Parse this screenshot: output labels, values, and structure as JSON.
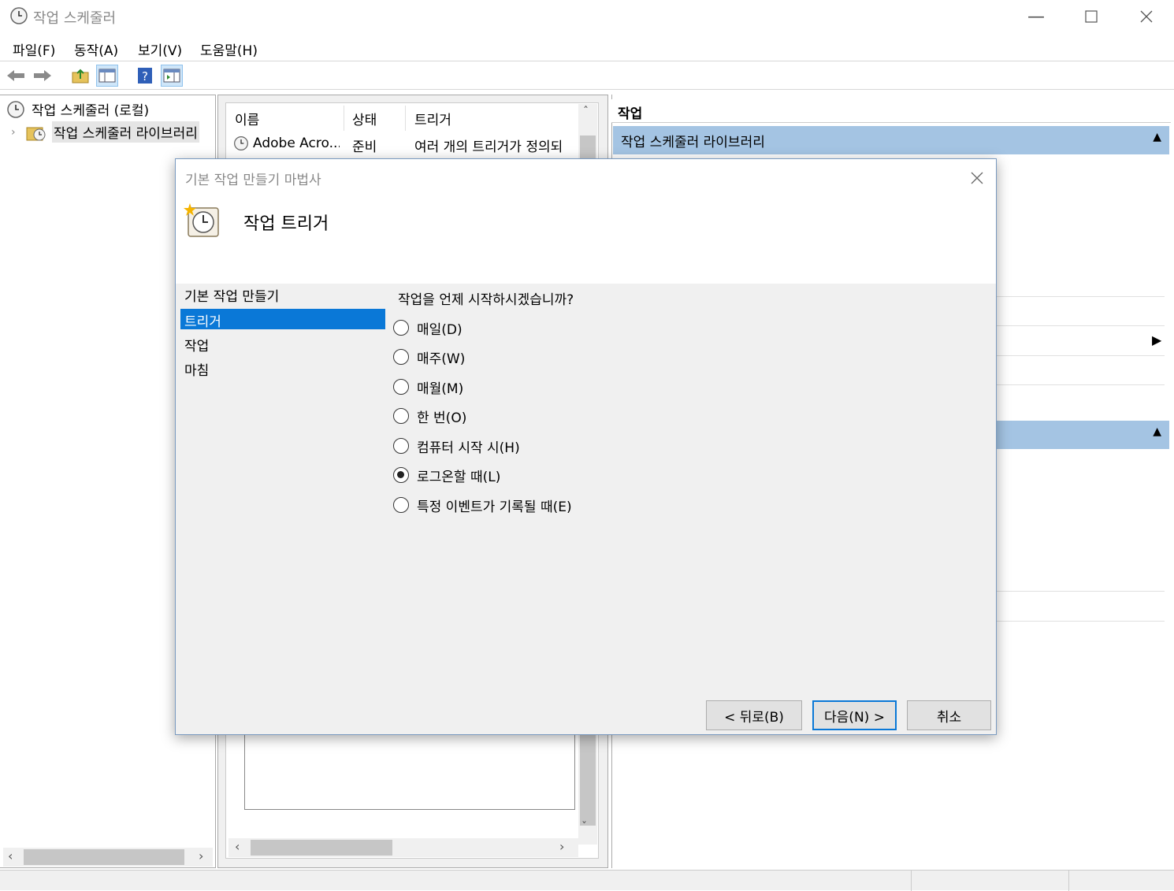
{
  "window": {
    "title": "작업 스케줄러"
  },
  "menu": {
    "items": [
      "파일(F)",
      "동작(A)",
      "보기(V)",
      "도움말(H)"
    ]
  },
  "tree": {
    "root": "작업 스케줄러 (로컬)",
    "library": "작업 스케줄러 라이브러리"
  },
  "list": {
    "columns": [
      "이름",
      "상태",
      "트리거"
    ],
    "rows": [
      {
        "name": "Adobe Acro...",
        "status": "준비",
        "trigger": "여러 개의 트리거가 정의되"
      }
    ]
  },
  "actions": {
    "header": "작업",
    "section": "작업 스케줄러 라이브러리"
  },
  "dialog": {
    "title": "기본 작업 만들기 마법사",
    "heading": "작업 트리거",
    "steps": [
      "기본 작업 만들기",
      "트리거",
      "작업",
      "마침"
    ],
    "selected_step": "트리거",
    "question": "작업을 언제 시작하시겠습니까?",
    "options": [
      "매일(D)",
      "매주(W)",
      "매월(M)",
      "한 번(O)",
      "컴퓨터 시작 시(H)",
      "로그온할 때(L)",
      "특정 이벤트가 기록될 때(E)"
    ],
    "selected_option": "로그온할 때(L)",
    "buttons": {
      "back": "< 뒤로(B)",
      "next": "다음(N) >",
      "cancel": "취소"
    }
  },
  "colors": {
    "accent": "#0a78d7",
    "section_bar": "#a4c4e3"
  }
}
